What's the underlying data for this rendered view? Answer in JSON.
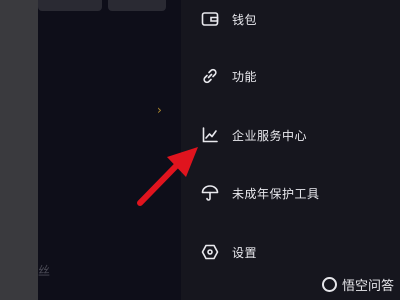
{
  "menu": {
    "items": [
      {
        "label": "钱包",
        "icon": "wallet-icon"
      },
      {
        "label": "功能",
        "icon": "link-icon"
      },
      {
        "label": "企业服务中心",
        "icon": "chart-line-icon"
      },
      {
        "label": "未成年保护工具",
        "icon": "umbrella-icon"
      },
      {
        "label": "设置",
        "icon": "settings-hexagon-icon"
      }
    ]
  },
  "background": {
    "chevron": "›",
    "hint": "丝"
  },
  "watermark": {
    "text": "悟空问答",
    "logo_icon": "wukong-logo-icon"
  },
  "colors": {
    "drawer_bg": "#16161e",
    "arrow": "#e0141e",
    "menu_text": "#e9e9ee"
  }
}
